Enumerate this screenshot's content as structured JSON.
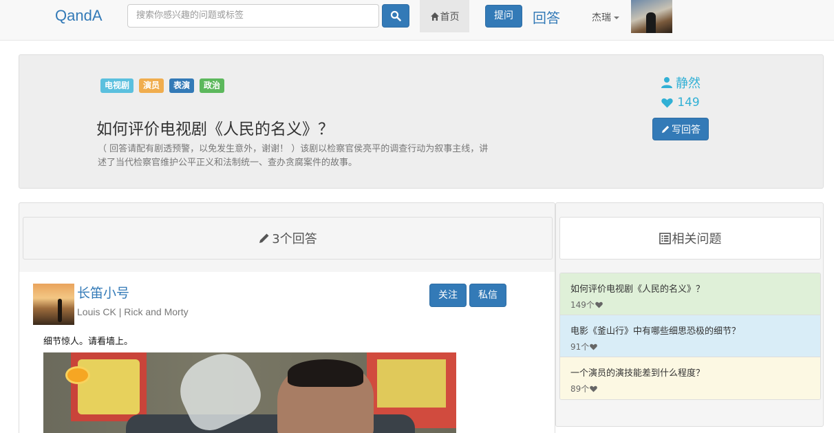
{
  "navbar": {
    "brand": "QandA",
    "search_placeholder": "搜索你感兴趣的问题或标签",
    "home_label": "首页",
    "ask_label": "提问",
    "answer_label": "回答",
    "user_name": "杰瑞"
  },
  "question": {
    "tags": [
      {
        "label": "电视剧",
        "color": "#5bc0de"
      },
      {
        "label": "演员",
        "color": "#f0ad4e"
      },
      {
        "label": "表演",
        "color": "#337ab7"
      },
      {
        "label": "政治",
        "color": "#5cb85c"
      }
    ],
    "title": "如何评价电视剧《人民的名义》？",
    "description": "（ 回答请配有剧透预警，以免发生意外，谢谢！ ）该剧以检察官侯亮平的调查行动为叙事主线，讲述了当代检察官维护公平正义和法制统一、查办贪腐案件的故事。",
    "author": "静然",
    "likes": "149",
    "write_answer_label": "写回答"
  },
  "answers": {
    "header": "3个回答",
    "items": [
      {
        "author": "长笛小号",
        "bio": "Louis CK | Rick and Morty",
        "follow_label": "关注",
        "message_label": "私信",
        "text": "细节惊人。请看墙上。"
      }
    ]
  },
  "related": {
    "header": "相关问题",
    "items": [
      {
        "title": "如何评价电视剧《人民的名义》？",
        "count": "149个",
        "bg": "#dff0d8"
      },
      {
        "title": "电影《釜山行》中有哪些细思恐极的细节？",
        "count": "91个",
        "bg": "#d9edf7"
      },
      {
        "title": "一个演员的演技能差到什么程度？",
        "count": "89个",
        "bg": "#fcf8e3"
      }
    ]
  }
}
